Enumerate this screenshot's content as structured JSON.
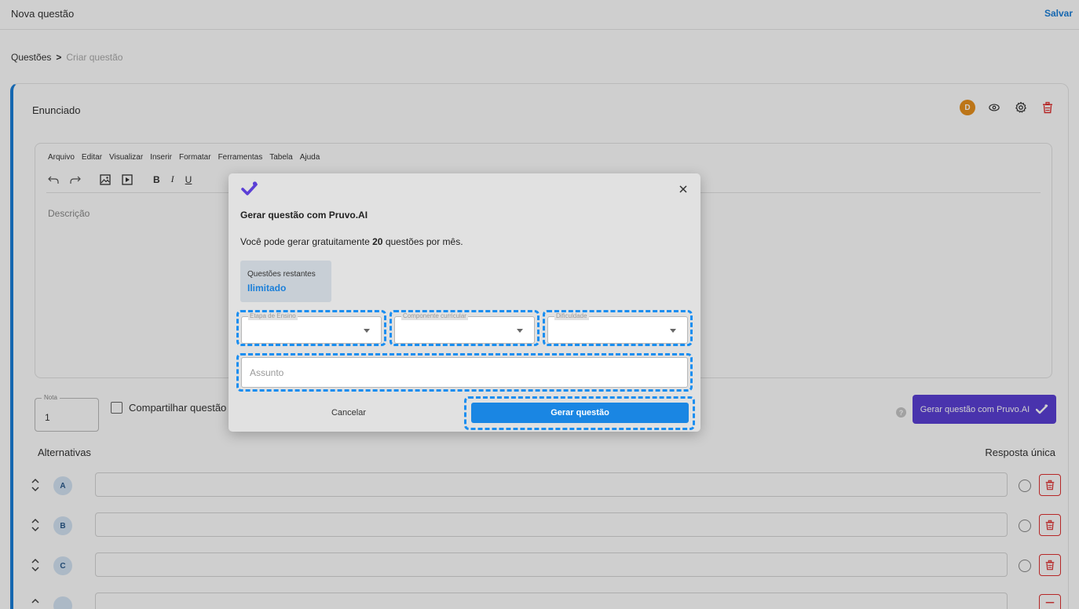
{
  "topbar": {
    "title": "Nova questão",
    "save_label": "Salvar"
  },
  "breadcrumb": {
    "first": "Questões",
    "separator": ">",
    "current": "Criar questão"
  },
  "card": {
    "title": "Enunciado",
    "avatar_initial": "D",
    "icons": [
      "eye-icon",
      "gear-icon",
      "trash-icon"
    ]
  },
  "editor": {
    "menu": [
      "Arquivo",
      "Editar",
      "Visualizar",
      "Inserir",
      "Formatar",
      "Ferramentas",
      "Tabela",
      "Ajuda"
    ],
    "toolbar": [
      "undo-icon",
      "redo-icon",
      "image-icon",
      "media-icon",
      "bold",
      "italic",
      "underline"
    ],
    "bold_label": "B",
    "italic_label": "I",
    "underline_label": "U",
    "placeholder": "Descrição"
  },
  "nota": {
    "label": "Nota",
    "value": "1"
  },
  "share": {
    "label": "Compartilhar questão c"
  },
  "help_label": "?",
  "ai_button": {
    "label": "Gerar questão com Pruvo.AI"
  },
  "alternatives": {
    "title": "Alternativas",
    "answer_type": "Resposta única",
    "items": [
      {
        "letter": "A"
      },
      {
        "letter": "B"
      },
      {
        "letter": "C"
      }
    ]
  },
  "modal": {
    "title": "Gerar questão com Pruvo.AI",
    "description_prefix": "Você pode gerar gratuitamente ",
    "description_count": "20",
    "description_suffix": " questões por mês.",
    "remaining_label": "Questões restantes",
    "remaining_value": "Ilimitado",
    "selects": {
      "etapa": "Etapa de Ensino",
      "componente": "Componente curricular",
      "dificuldade": "Dificuldade"
    },
    "assunto_placeholder": "Assunto",
    "cancel_label": "Cancelar",
    "generate_label": "Gerar questão"
  },
  "colors": {
    "primary": "#1a86e3",
    "ai_purple": "#5b3fd6",
    "danger": "#e03030",
    "avatar": "#e8901e",
    "highlight": "#1a8ef0"
  }
}
